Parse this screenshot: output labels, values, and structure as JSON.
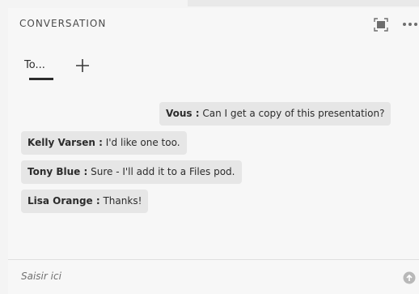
{
  "panel": {
    "title": "CONVERSATION"
  },
  "icons": {
    "fullscreen": "fullscreen-icon",
    "more": "more-icon",
    "add": "add-tab-icon",
    "send": "send-icon"
  },
  "tabs": [
    {
      "label": "To...",
      "active": true
    }
  ],
  "messages": [
    {
      "sender": "Vous :",
      "text": " Can I get a copy of this presentation?",
      "align": "right"
    },
    {
      "sender": "Kelly Varsen :",
      "text": " I'd like one too.",
      "align": "left"
    },
    {
      "sender": "Tony Blue :",
      "text": " Sure - I'll add it to a Files pod.",
      "align": "left"
    },
    {
      "sender": "Lisa Orange :",
      "text": " Thanks!",
      "align": "left"
    }
  ],
  "composer": {
    "placeholder": "Saisir ici"
  },
  "colors": {
    "panel_bg": "#f7f7f7",
    "bubble_bg": "#e6e6e6",
    "text": "#2c2c2c"
  }
}
